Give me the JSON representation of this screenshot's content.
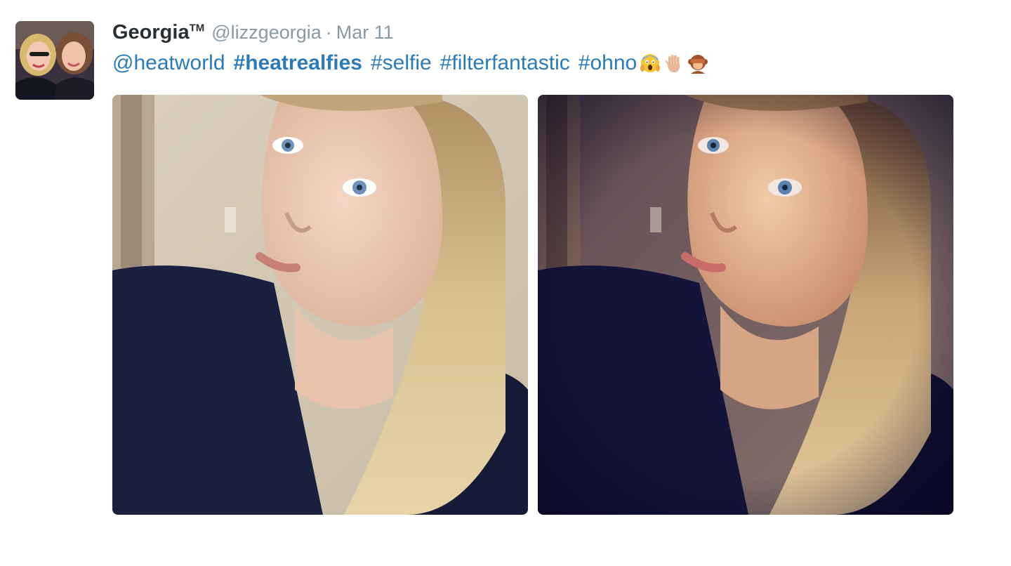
{
  "tweet": {
    "display_name": "Georgia",
    "tm_mark": "TM",
    "handle": "@lizzgeorgia",
    "separator": "·",
    "timestamp": "Mar 11",
    "text_segments": [
      {
        "text": "@heatworld",
        "kind": "mention"
      },
      {
        "text": "#heatrealfies",
        "kind": "hashtag-bold"
      },
      {
        "text": "#selfie",
        "kind": "hashtag"
      },
      {
        "text": "#filterfantastic",
        "kind": "hashtag"
      },
      {
        "text": "#ohno",
        "kind": "hashtag"
      }
    ],
    "emojis": [
      "screaming-face-emoji",
      "raised-hand-emoji",
      "see-no-evil-monkey-emoji"
    ],
    "photos": [
      "selfie-unfiltered-photo",
      "selfie-filtered-photo"
    ]
  },
  "colors": {
    "link": "#2b7bb9",
    "name": "#292f33",
    "meta": "#8899a6"
  }
}
